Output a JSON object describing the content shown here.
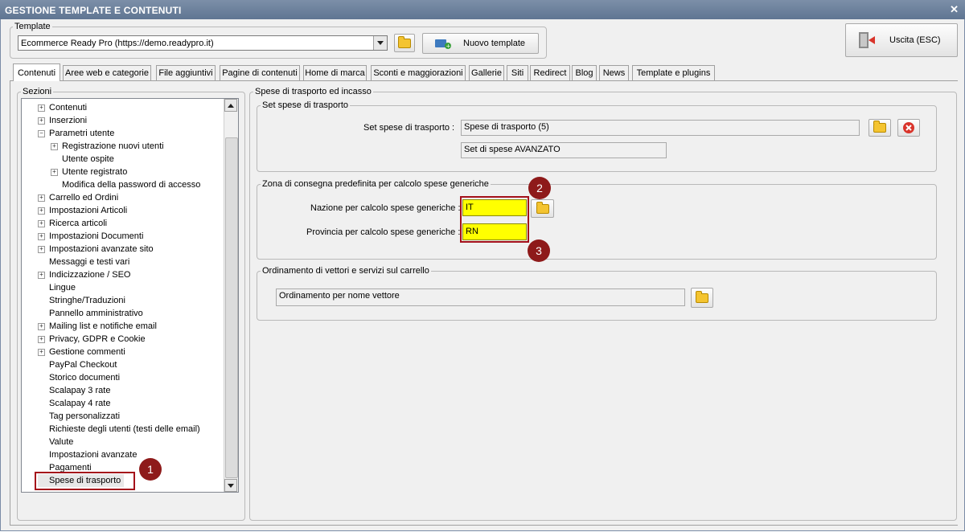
{
  "window": {
    "title": "GESTIONE TEMPLATE E CONTENUTI"
  },
  "template": {
    "group_label": "Template",
    "selected": "Ecommerce Ready Pro (https://demo.readypro.it)",
    "new_button": "Nuovo template",
    "exit_button": "Uscita (ESC)"
  },
  "tabs": [
    "Contenuti",
    "Aree web e categorie",
    "File aggiuntivi",
    "Pagine di contenuti",
    "Home di marca",
    "Sconti e maggiorazioni",
    "Gallerie",
    "Siti",
    "Redirect",
    "Blog",
    "News",
    "Template e plugins"
  ],
  "sections": {
    "label": "Sezioni",
    "items": [
      "Contenuti",
      "Inserzioni",
      "Parametri utente",
      "Registrazione nuovi utenti",
      "Utente ospite",
      "Utente registrato",
      "Modifica della password di accesso",
      "Carrello ed Ordini",
      "Impostazioni Articoli",
      "Ricerca articoli",
      "Impostazioni Documenti",
      "Impostazioni avanzate sito",
      "Messaggi e testi vari",
      "Indicizzazione / SEO",
      "Lingue",
      "Stringhe/Traduzioni",
      "Pannello amministrativo",
      "Mailing list e notifiche email",
      "Privacy, GDPR e Cookie",
      "Gestione commenti",
      "PayPal Checkout",
      "Storico documenti",
      "Scalapay 3 rate",
      "Scalapay 4 rate",
      "Tag personalizzati",
      "Richieste degli utenti (testi delle email)",
      "Valute",
      "Impostazioni avanzate",
      "Pagamenti",
      "Spese di trasporto"
    ]
  },
  "right": {
    "title": "Spese di trasporto ed incasso",
    "set_group": "Set spese di trasporto",
    "set_label": "Set spese di trasporto :",
    "set_value": "Spese di trasporto (5)",
    "set_sub": "Set di spese AVANZATO",
    "zone_group": "Zona di consegna predefinita per calcolo spese generiche",
    "nation_label": "Nazione per calcolo spese generiche :",
    "nation_value": "IT",
    "province_label": "Provincia per calcolo spese generiche :",
    "province_value": "RN",
    "order_group": "Ordinamento di vettori e servizi sul carrello",
    "order_value": "Ordinamento per nome vettore"
  },
  "badges": [
    "1",
    "2",
    "3"
  ],
  "colors": {
    "highlight": "#ffff00",
    "annotation": "#a4101a",
    "titlebar": "#6b819c"
  }
}
